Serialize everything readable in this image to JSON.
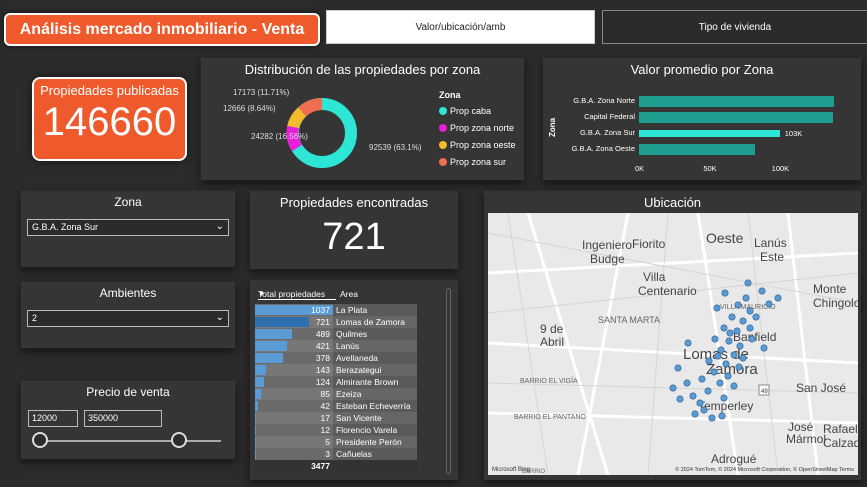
{
  "header": {
    "title": "Análisis mercado inmobiliario - Venta",
    "tabs": [
      "Valor/ubicación/amb",
      "Tipo de vivienda"
    ]
  },
  "kpi_publicadas": {
    "label": "Propiedades publicadas",
    "value": "146660"
  },
  "donut": {
    "title": "Distribución de las propiedades por zona",
    "legend_title": "Zona",
    "labels": [
      "17173 (11.71%)",
      "12666 (8.64%)",
      "24282 (16.56%)",
      "92539 (63.1%)"
    ],
    "items": [
      {
        "name": "Prop caba",
        "color": "#2ee6d6"
      },
      {
        "name": "Prop zona norte",
        "color": "#e91ed8"
      },
      {
        "name": "Prop zona oeste",
        "color": "#f5bb2c"
      },
      {
        "name": "Prop zona sur",
        "color": "#ee6e4f"
      }
    ]
  },
  "chart_data": {
    "type": "bar",
    "title": "Valor promedio por Zona",
    "ylabel": "Zona",
    "categories": [
      "G.B.A. Zona Norte",
      "Capital Federal",
      "G.B.A. Zona Sur",
      "G.B.A. Zona Oeste"
    ],
    "values": [
      143000,
      142000,
      103000,
      85000
    ],
    "highlight": "G.B.A. Zona Sur",
    "data_label": "103K",
    "xticks": [
      "0K",
      "50K",
      "100K"
    ],
    "xlim": [
      0,
      150000
    ]
  },
  "filters": {
    "zona": {
      "label": "Zona",
      "value": "G.B.A. Zona Sur"
    },
    "ambientes": {
      "label": "Ambientes",
      "value": "2"
    },
    "precio": {
      "label": "Precio de venta",
      "min": "12000",
      "max": "350000"
    }
  },
  "kpi_encontradas": {
    "label": "Propiedades encontradas",
    "value": "721"
  },
  "table": {
    "headers": [
      "Total propiedades",
      "Area"
    ],
    "rows": [
      {
        "n": "1037",
        "area": "La Plata",
        "v": 1037
      },
      {
        "n": "721",
        "area": "Lomas de Zamora",
        "v": 721
      },
      {
        "n": "489",
        "area": "Quilmes",
        "v": 489
      },
      {
        "n": "421",
        "area": "Lanús",
        "v": 421
      },
      {
        "n": "378",
        "area": "Avellaneda",
        "v": 378
      },
      {
        "n": "143",
        "area": "Berazategui",
        "v": 143
      },
      {
        "n": "124",
        "area": "Almirante Brown",
        "v": 124
      },
      {
        "n": "85",
        "area": "Ezeiza",
        "v": 85
      },
      {
        "n": "42",
        "area": "Esteban Echeverría",
        "v": 42
      },
      {
        "n": "17",
        "area": "San Vicente",
        "v": 17
      },
      {
        "n": "12",
        "area": "Florencio Varela",
        "v": 12
      },
      {
        "n": "5",
        "area": "Presidente Perón",
        "v": 5
      },
      {
        "n": "3",
        "area": "Cañuelas",
        "v": 3
      }
    ],
    "total": "3477"
  },
  "map": {
    "title": "Ubicación",
    "places": [
      "Oeste",
      "Lanús",
      "Este",
      "Ingeniero",
      "Budge",
      "Fiorito",
      "Villa",
      "Centenario",
      "Monte",
      "Chingolo",
      "9 de",
      "Abril",
      "Lomas de",
      "Zamora",
      "Banfield",
      "San José",
      "Temperley",
      "Adrogué",
      "José",
      "Mármol",
      "Rafael",
      "Calzada",
      "Villa",
      "Centenario"
    ],
    "streets": [
      "VILLA MAURICIO",
      "SANTA MARTA",
      "BARRIO EL VIGÍA",
      "BARRIO EL PANTANO",
      "BARRIO"
    ],
    "attribution": "© 2024 TomTom, © 2024 Microsoft Corporation, © OpenStreetMap  Terms",
    "brand": "Microsoft Bing",
    "route": "49"
  }
}
